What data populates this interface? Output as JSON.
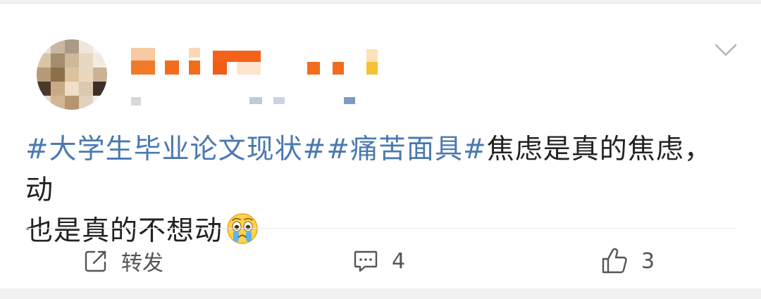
{
  "post": {
    "hashtags": [
      "#大学生毕业论文现状#",
      "#痛苦面具#"
    ],
    "text_line1": "焦虑是真的焦虑，动",
    "text_line2": "也是真的不想动",
    "emoji": "crying-face-emoji"
  },
  "actions": {
    "repost_label": "转发",
    "comment_count": "4",
    "like_count": "3"
  },
  "colors": {
    "hashtag": "#4a79b0",
    "text": "#222222",
    "action": "#555555",
    "background": "#f1f1f1"
  }
}
